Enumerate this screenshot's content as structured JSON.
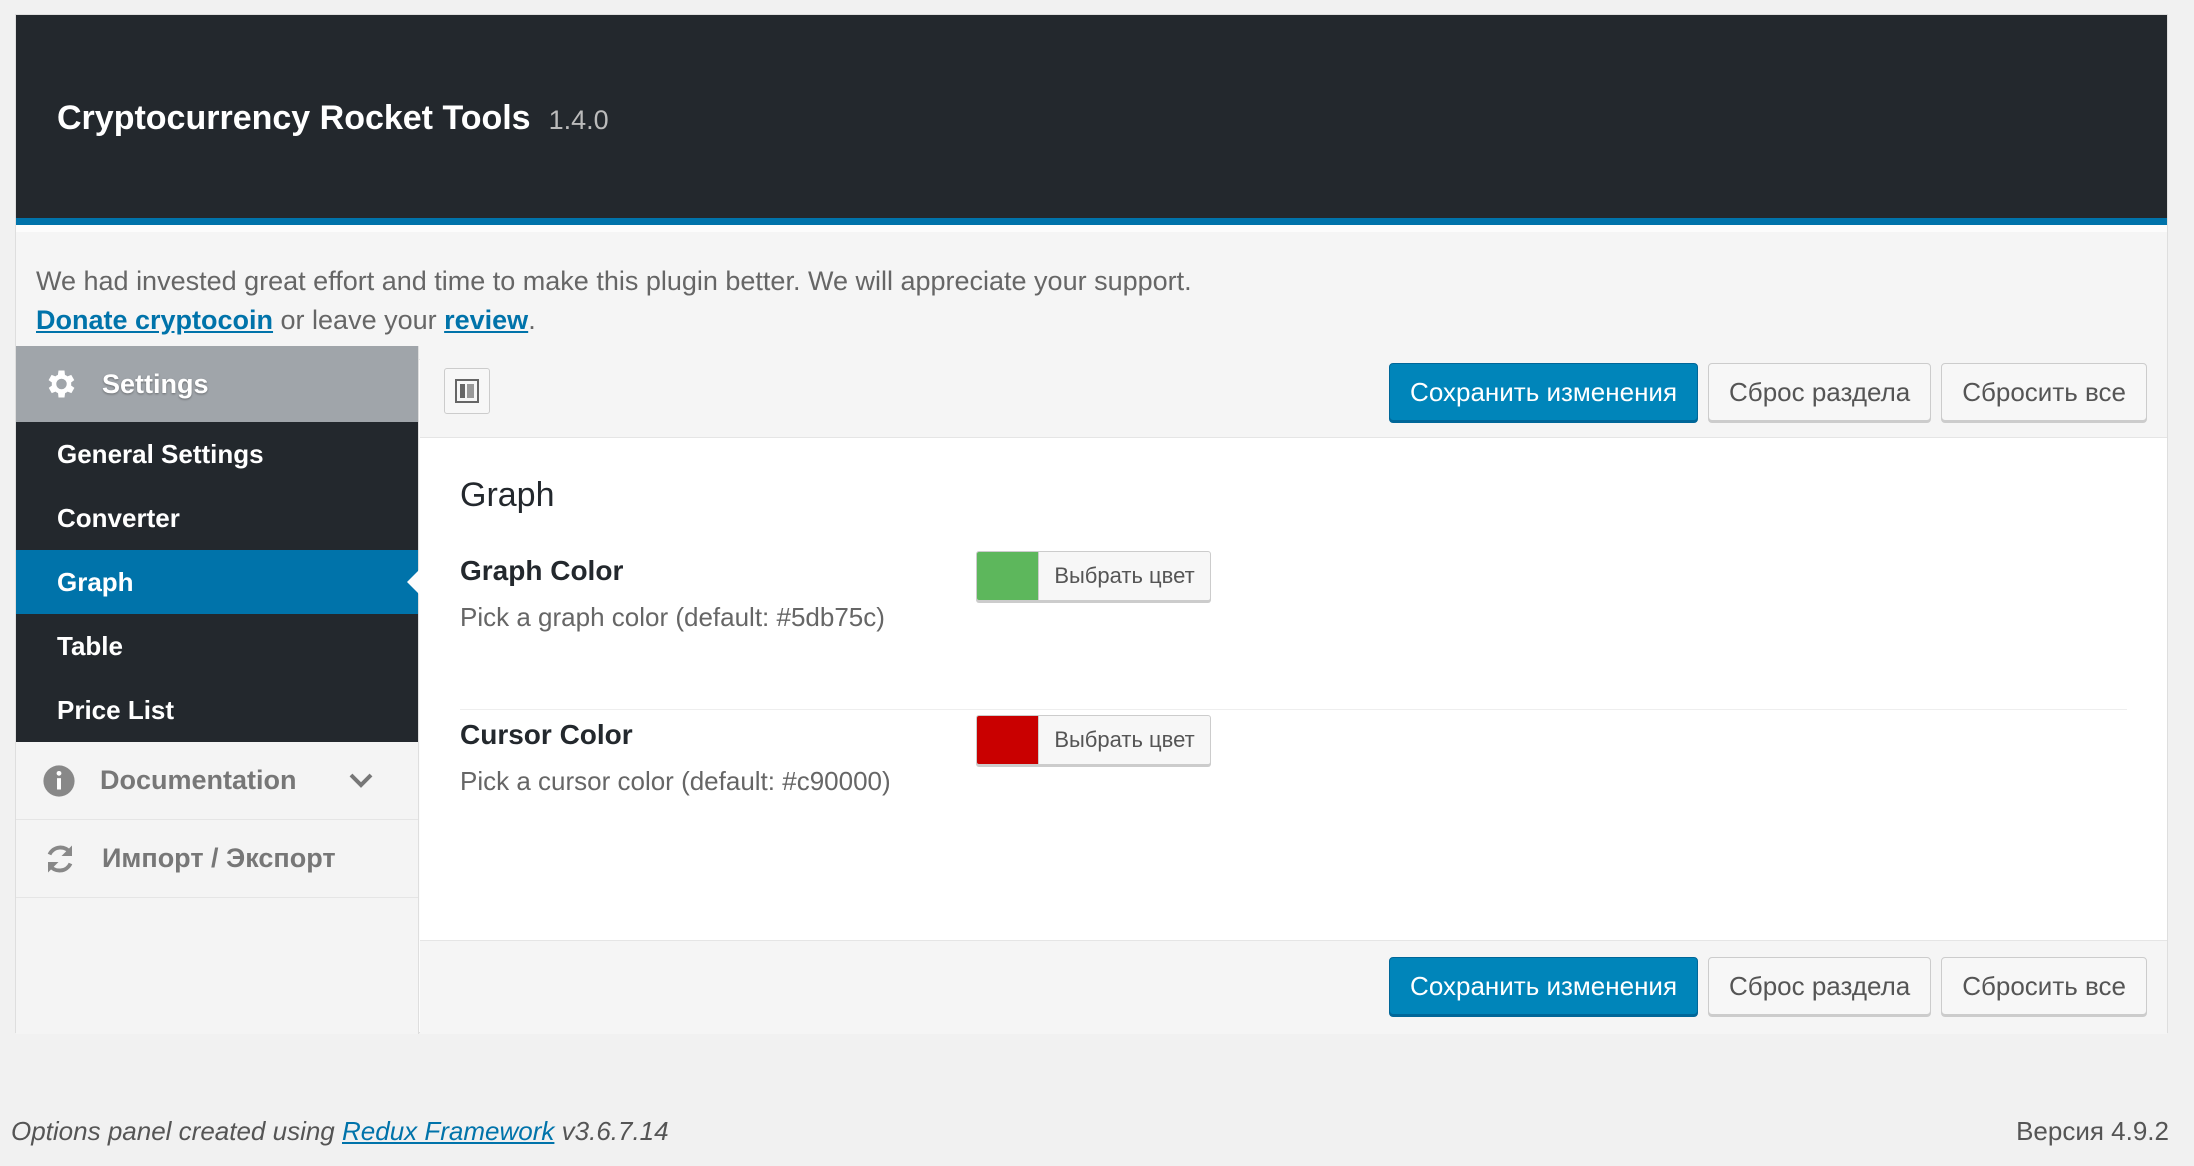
{
  "header": {
    "title": "Cryptocurrency Rocket Tools",
    "version": "1.4.0"
  },
  "notice": {
    "text": "We had invested great effort and time to make this plugin better. We will appreciate your support.",
    "donate_link": "Donate cryptocoin",
    "middle": " or leave your ",
    "review_link": "review",
    "end": "."
  },
  "sidebar": {
    "settings_label": "Settings",
    "sub_items": [
      "General Settings",
      "Converter",
      "Graph",
      "Table",
      "Price List"
    ],
    "active_index": 2,
    "documentation_label": "Documentation",
    "import_export_label": "Импорт / Экспорт"
  },
  "toolbar": {
    "save_label": "Сохранить изменения",
    "reset_section_label": "Сброс раздела",
    "reset_all_label": "Сбросить все"
  },
  "section": {
    "title": "Graph",
    "fields": [
      {
        "title": "Graph Color",
        "desc": "Pick a graph color (default: #5db75c)",
        "color": "#5db75c",
        "button_label": "Выбрать цвет"
      },
      {
        "title": "Cursor Color",
        "desc": "Pick a cursor color (default: #c90000)",
        "color": "#c90000",
        "button_label": "Выбрать цвет"
      }
    ]
  },
  "footer": {
    "prefix": "Options panel created using ",
    "link": "Redux Framework",
    "suffix": " v3.6.7.14",
    "version": "Версия 4.9.2"
  },
  "colors": {
    "accent": "#0073aa",
    "header_bg": "#23282d",
    "primary_button": "#0085ba"
  }
}
